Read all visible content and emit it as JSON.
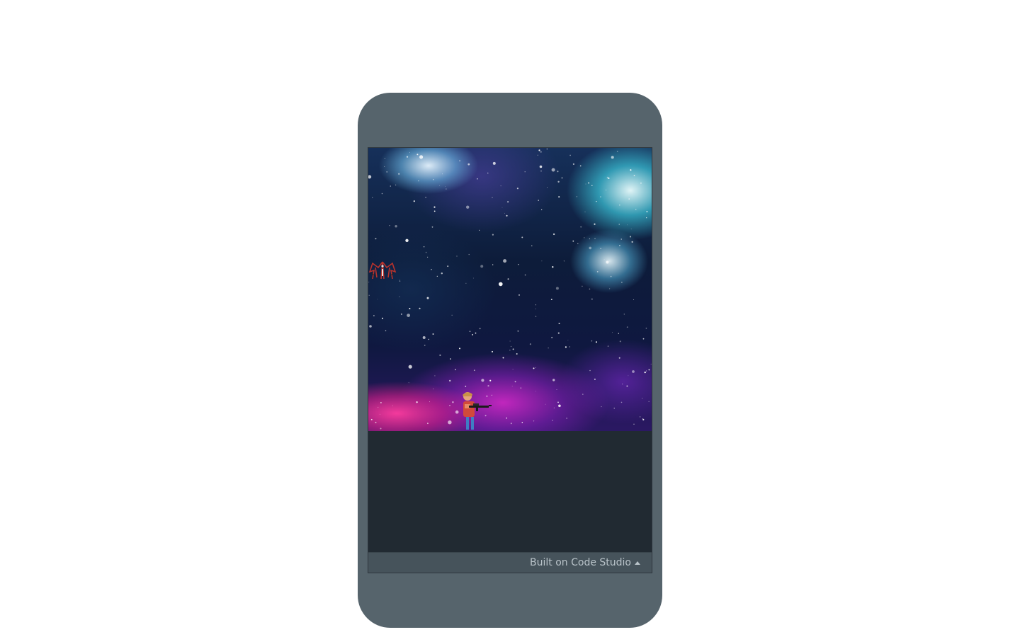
{
  "app": {
    "game_scene": {
      "background": "space-nebula",
      "sprites": [
        {
          "name": "enemy-bat-ship",
          "color": "#b8322c"
        },
        {
          "name": "player-soldier-with-rifle",
          "color": "#d24a3a"
        }
      ]
    },
    "footer": {
      "label": "Built on Code Studio",
      "icon": "caret-up-icon"
    }
  },
  "colors": {
    "phone_frame": "#56646c",
    "screen_bg": "#212a32",
    "footer_bg": "#46535b",
    "footer_text": "#b9c3c9"
  }
}
